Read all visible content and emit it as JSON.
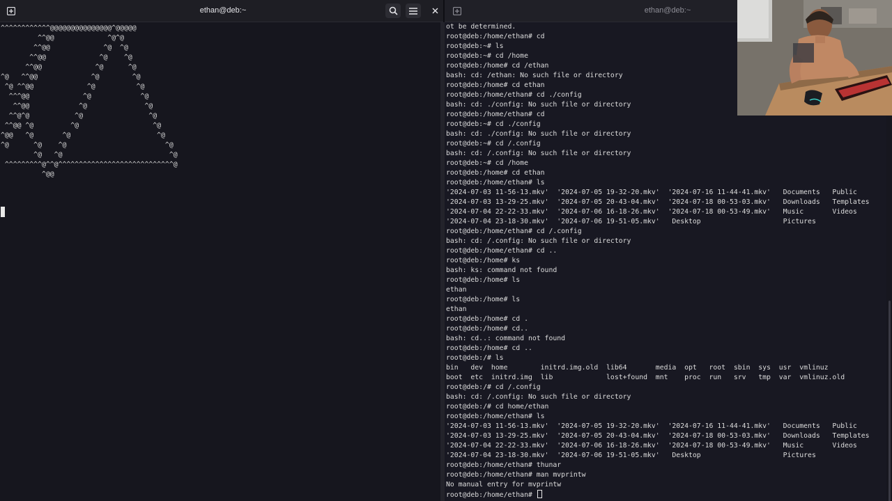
{
  "left_window": {
    "title": "ethan@deb:~",
    "new_tab_icon": "new-tab-icon",
    "search_icon": "search-icon",
    "menu_icon": "hamburger-menu-icon",
    "close_icon": "close-icon",
    "ascii_art": [
      "^^^^^^^^^^^^@@@@@@@@@@@@@@@^@@@@@",
      "         ^^@@             ^@^@",
      "        ^^@@             ^@  ^@",
      "       ^^@@             ^@    ^@",
      "      ^^@@             ^@      ^@",
      "^@   ^^@@             ^@        ^@",
      " ^@ ^^@@             ^@          ^@",
      "  ^^^@@             ^@            ^@",
      "   ^^@@            ^@              ^@",
      "  ^^@^@           ^@                ^@",
      " ^^@@ ^@         ^@                  ^@",
      "^@@   ^@       ^@                     ^@",
      "^@      ^@    ^@                        ^@",
      "        ^@   ^@                          ^@",
      " ^^^^^^^^^@^^@^^^^^^^^^^^^^^^^^^^^^^^^^^^^@",
      "          ^@@"
    ]
  },
  "right_window": {
    "title": "ethan@deb:~",
    "new_tab_icon": "new-tab-icon",
    "lines": [
      "ot be determined.",
      "root@deb:/home/ethan# cd",
      "root@deb:~# ls",
      "root@deb:~# cd /home",
      "root@deb:/home# cd /ethan",
      "bash: cd: /ethan: No such file or directory",
      "root@deb:/home# cd ethan",
      "root@deb:/home/ethan# cd ./config",
      "bash: cd: ./config: No such file or directory",
      "root@deb:/home/ethan# cd",
      "root@deb:~# cd ./config",
      "bash: cd: ./config: No such file or directory",
      "root@deb:~# cd /.config",
      "bash: cd: /.config: No such file or directory",
      "root@deb:~# cd /home",
      "root@deb:/home# cd ethan",
      "root@deb:/home/ethan# ls",
      "'2024-07-03 11-56-13.mkv'  '2024-07-05 19-32-20.mkv'  '2024-07-16 11-44-41.mkv'   Documents   Public",
      "'2024-07-03 13-29-25.mkv'  '2024-07-05 20-43-04.mkv'  '2024-07-18 00-53-03.mkv'   Downloads   Templates",
      "'2024-07-04 22-22-33.mkv'  '2024-07-06 16-18-26.mkv'  '2024-07-18 00-53-49.mkv'   Music       Videos",
      "'2024-07-04 23-18-30.mkv'  '2024-07-06 19-51-05.mkv'   Desktop                    Pictures",
      "root@deb:/home/ethan# cd /.config",
      "bash: cd: /.config: No such file or directory",
      "root@deb:/home/ethan# cd ..",
      "root@deb:/home# ks",
      "bash: ks: command not found",
      "root@deb:/home# ls",
      "ethan",
      "root@deb:/home# ls",
      "ethan",
      "root@deb:/home# cd .",
      "root@deb:/home# cd..",
      "bash: cd..: command not found",
      "root@deb:/home# cd ..",
      "root@deb:/# ls",
      "bin   dev  home        initrd.img.old  lib64       media  opt   root  sbin  sys  usr  vmlinuz",
      "boot  etc  initrd.img  lib             lost+found  mnt    proc  run   srv   tmp  var  vmlinuz.old",
      "root@deb:/# cd /.config",
      "bash: cd: /.config: No such file or directory",
      "root@deb:/# cd home/ethan",
      "root@deb:/home/ethan# ls",
      "'2024-07-03 11-56-13.mkv'  '2024-07-05 19-32-20.mkv'  '2024-07-16 11-44-41.mkv'   Documents   Public",
      "'2024-07-03 13-29-25.mkv'  '2024-07-05 20-43-04.mkv'  '2024-07-18 00-53-03.mkv'   Downloads   Templates",
      "'2024-07-04 22-22-33.mkv'  '2024-07-06 16-18-26.mkv'  '2024-07-18 00-53-49.mkv'   Music       Videos",
      "'2024-07-04 23-18-30.mkv'  '2024-07-06 19-51-05.mkv'   Desktop                    Pictures",
      "root@deb:/home/ethan# thunar",
      "root@deb:/home/ethan# man mvprintw",
      "No manual entry for mvprintw"
    ],
    "prompt": "root@deb:/home/ethan# "
  },
  "webcam": {
    "icon": "webcam-overlay-image"
  }
}
